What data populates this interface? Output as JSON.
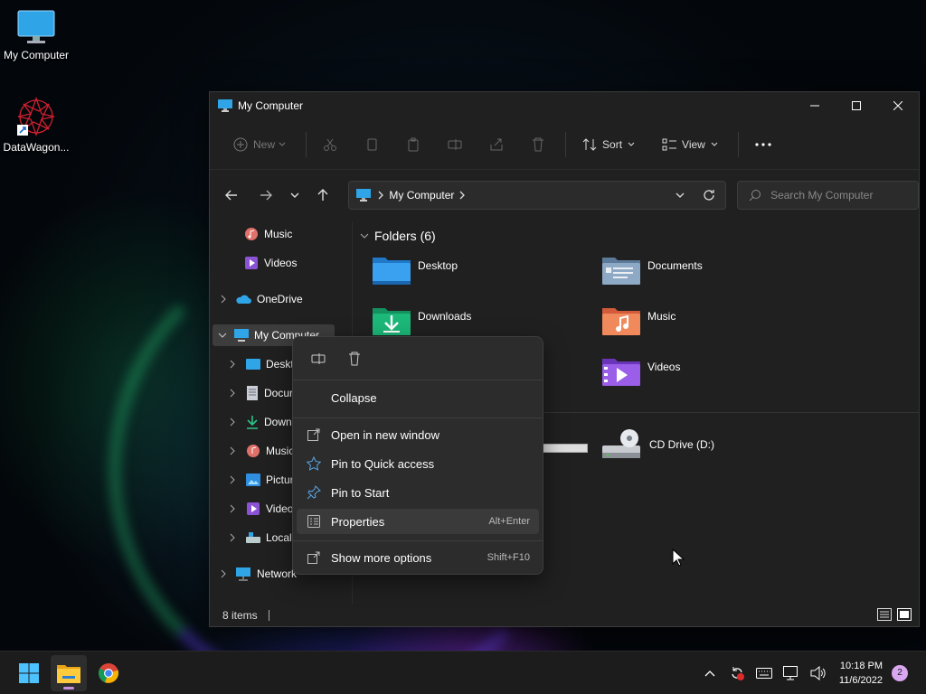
{
  "desktop": {
    "icons": [
      {
        "label": "My Computer"
      },
      {
        "label": "DataWagon..."
      }
    ]
  },
  "window": {
    "title": "My Computer",
    "toolbar": {
      "new_label": "New",
      "sort_label": "Sort",
      "view_label": "View"
    },
    "address": {
      "crumb": "My Computer"
    },
    "search": {
      "placeholder": "Search My Computer"
    },
    "sidebar": {
      "items": [
        {
          "label": "Music"
        },
        {
          "label": "Videos"
        },
        {
          "label": "OneDrive"
        },
        {
          "label": "My Computer"
        },
        {
          "label": "Deskto"
        },
        {
          "label": "Docur"
        },
        {
          "label": "Down"
        },
        {
          "label": "Music"
        },
        {
          "label": "Pictur"
        },
        {
          "label": "Videos"
        },
        {
          "label": "Local"
        },
        {
          "label": "Network"
        }
      ]
    },
    "content": {
      "group_title": "Folders (6)",
      "folders": [
        {
          "label": "Desktop"
        },
        {
          "label": "Documents"
        },
        {
          "label": "Downloads"
        },
        {
          "label": "Music"
        },
        {
          "label": "Videos"
        }
      ],
      "drives": [
        {
          "label": "CD Drive (D:)"
        }
      ]
    },
    "status": {
      "items_count": "8 items"
    }
  },
  "context_menu": {
    "items": [
      {
        "label": "Collapse",
        "shortcut": ""
      },
      {
        "label": "Open in new window",
        "shortcut": ""
      },
      {
        "label": "Pin to Quick access",
        "shortcut": ""
      },
      {
        "label": "Pin to Start",
        "shortcut": ""
      },
      {
        "label": "Properties",
        "shortcut": "Alt+Enter"
      },
      {
        "label": "Show more options",
        "shortcut": "Shift+F10"
      }
    ]
  },
  "taskbar": {
    "clock_time": "10:18 PM",
    "clock_date": "11/6/2022",
    "notification_count": "2"
  },
  "colors": {
    "accent": "#2fa4e7",
    "folder_blue": "#3aa0f0",
    "window_bg": "#202020",
    "menu_bg": "#2c2c2c",
    "notif_badge": "#d9a6f0"
  }
}
